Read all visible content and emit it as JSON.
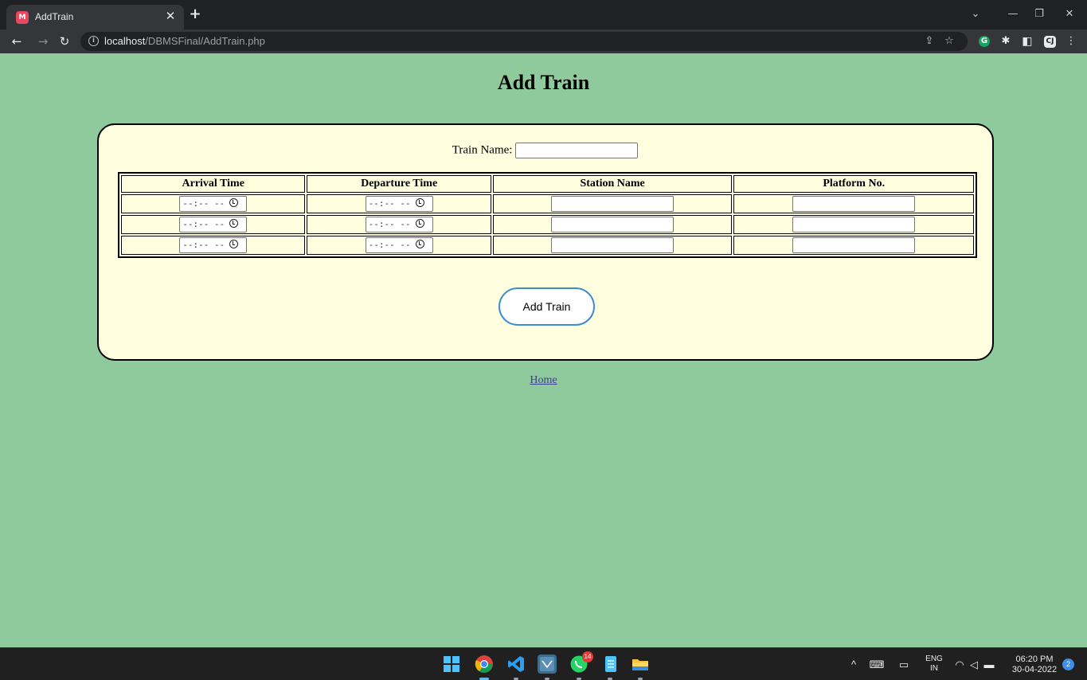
{
  "browser": {
    "tab_title": "AddTrain",
    "tab_favicon": "M",
    "url_host": "localhost",
    "url_path": "/DBMSFinal/AddTrain.php",
    "extensions": {
      "grammarly": "G",
      "cj": "CJ"
    }
  },
  "page": {
    "title": "Add Train",
    "train_name_label": "Train Name:",
    "train_name_value": "",
    "columns": [
      "Arrival Time",
      "Departure Time",
      "Station Name",
      "Platform No."
    ],
    "time_placeholder": "--:-- --",
    "rows": [
      {
        "arrival": "",
        "departure": "",
        "station": "",
        "platform": ""
      },
      {
        "arrival": "",
        "departure": "",
        "station": "",
        "platform": ""
      },
      {
        "arrival": "",
        "departure": "",
        "station": "",
        "platform": ""
      }
    ],
    "submit_label": "Add Train",
    "home_link": "Home",
    "colors": {
      "background": "#8fca9c",
      "card": "#ffffe0",
      "button_border": "#3a8ed1"
    }
  },
  "taskbar": {
    "whatsapp_badge": "14",
    "lang_top": "ENG",
    "lang_bottom": "IN",
    "time": "06:20 PM",
    "date": "30-04-2022",
    "notifications": "2"
  }
}
